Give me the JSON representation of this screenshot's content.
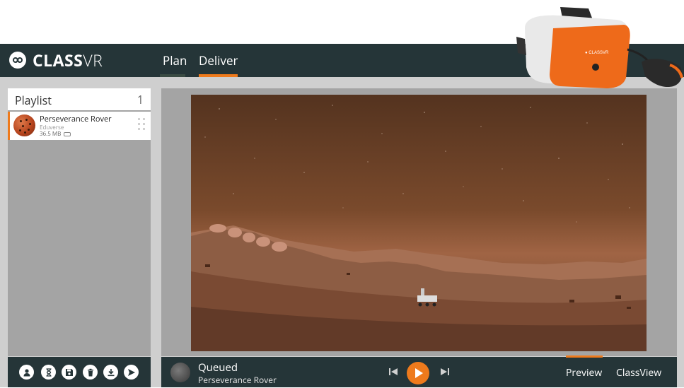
{
  "app": {
    "logo_text_bold": "CLASS",
    "logo_text_light": "VR"
  },
  "nav": {
    "tabs": [
      {
        "label": "Plan"
      },
      {
        "label": "Deliver"
      }
    ]
  },
  "playlist": {
    "title": "Playlist",
    "count": "1",
    "items": [
      {
        "title": "Perseverance Rover",
        "source": "Eduverse",
        "size": "36.5 MB"
      }
    ]
  },
  "toolbar": {
    "icons": [
      "user-icon",
      "hourglass-icon",
      "save-icon",
      "trash-icon",
      "download-icon",
      "send-icon"
    ]
  },
  "player": {
    "status": "Queued",
    "title": "Perseverance Rover",
    "preview_tab": "Preview",
    "classview_tab": "ClassView"
  },
  "colors": {
    "accent": "#ee7a1c",
    "dark": "#253538"
  }
}
